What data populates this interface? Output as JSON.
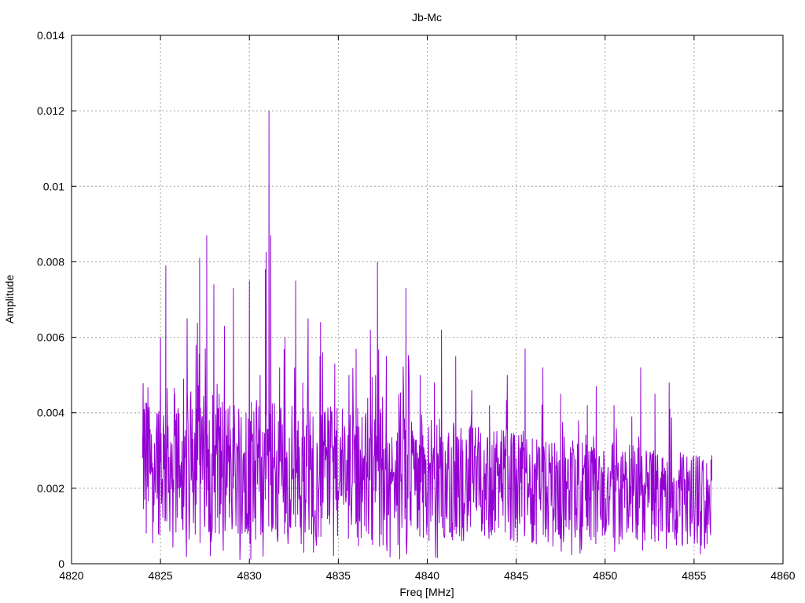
{
  "chart_data": {
    "type": "line",
    "title": "Jb-Mc",
    "xlabel": "Freq [MHz]",
    "ylabel": "Amplitude",
    "xlim": [
      4820,
      4860
    ],
    "ylim": [
      0,
      0.014
    ],
    "x_ticks": [
      "4820",
      "4825",
      "4830",
      "4835",
      "4840",
      "4845",
      "4850",
      "4855",
      "4860"
    ],
    "x_tick_values": [
      4820,
      4825,
      4830,
      4835,
      4840,
      4845,
      4850,
      4855,
      4860
    ],
    "y_ticks": [
      "0",
      "0.002",
      "0.004",
      "0.006",
      "0.008",
      "0.01",
      "0.012",
      "0.014"
    ],
    "y_tick_values": [
      0,
      0.002,
      0.004,
      0.006,
      0.008,
      0.01,
      0.012,
      0.014
    ],
    "grid": true,
    "legend": "none",
    "series": [
      {
        "color": "#9400d3",
        "x_start": 4824.0,
        "x_end": 4856.0,
        "points": [
          [
            4824.0,
            0.0028
          ],
          [
            4824.2,
            0.0008
          ],
          [
            4824.4,
            0.0024
          ],
          [
            4824.6,
            0.0011
          ],
          [
            4824.8,
            0.004
          ],
          [
            4825.0,
            0.006
          ],
          [
            4825.2,
            0.0025
          ],
          [
            4825.3,
            0.0079
          ],
          [
            4825.5,
            0.0018
          ],
          [
            4825.8,
            0.0045
          ],
          [
            4826.0,
            0.002
          ],
          [
            4826.3,
            0.0049
          ],
          [
            4826.5,
            0.0065
          ],
          [
            4826.8,
            0.0022
          ],
          [
            4827.0,
            0.0058
          ],
          [
            4827.2,
            0.0081
          ],
          [
            4827.4,
            0.003
          ],
          [
            4827.6,
            0.0087
          ],
          [
            4827.8,
            0.0002
          ],
          [
            4828.0,
            0.0074
          ],
          [
            4828.3,
            0.0045
          ],
          [
            4828.6,
            0.0063
          ],
          [
            4828.9,
            0.0016
          ],
          [
            4829.1,
            0.0073
          ],
          [
            4829.4,
            0.0041
          ],
          [
            4829.7,
            0.0029
          ],
          [
            4830.0,
            0.0075
          ],
          [
            4830.3,
            0.0012
          ],
          [
            4830.6,
            0.005
          ],
          [
            4830.9,
            0.0078
          ],
          [
            4831.1,
            0.012
          ],
          [
            4831.2,
            0.0087
          ],
          [
            4831.4,
            0.0028
          ],
          [
            4831.7,
            0.0052
          ],
          [
            4832.0,
            0.006
          ],
          [
            4832.3,
            0.0015
          ],
          [
            4832.6,
            0.0075
          ],
          [
            4833.0,
            0.0048
          ],
          [
            4833.3,
            0.0065
          ],
          [
            4833.6,
            0.0003
          ],
          [
            4834.0,
            0.0064
          ],
          [
            4834.4,
            0.0038
          ],
          [
            4834.8,
            0.0053
          ],
          [
            4835.2,
            0.0018
          ],
          [
            4835.6,
            0.005
          ],
          [
            4836.0,
            0.0057
          ],
          [
            4836.4,
            0.0028
          ],
          [
            4836.8,
            0.0062
          ],
          [
            4837.2,
            0.008
          ],
          [
            4837.4,
            0.004
          ],
          [
            4837.7,
            0.0055
          ],
          [
            4838.0,
            0.0021
          ],
          [
            4838.4,
            0.0045
          ],
          [
            4838.8,
            0.0073
          ],
          [
            4839.2,
            0.0034
          ],
          [
            4839.6,
            0.005
          ],
          [
            4840.0,
            0.001
          ],
          [
            4840.4,
            0.0048
          ],
          [
            4840.8,
            0.0062
          ],
          [
            4841.2,
            0.0025
          ],
          [
            4841.6,
            0.0055
          ],
          [
            4842.0,
            0.003
          ],
          [
            4842.5,
            0.0046
          ],
          [
            4843.0,
            0.0015
          ],
          [
            4843.5,
            0.0042
          ],
          [
            4844.0,
            0.0028
          ],
          [
            4844.5,
            0.005
          ],
          [
            4845.0,
            0.0012
          ],
          [
            4845.5,
            0.0057
          ],
          [
            4846.0,
            0.0025
          ],
          [
            4846.5,
            0.0052
          ],
          [
            4847.0,
            0.0032
          ],
          [
            4847.5,
            0.0045
          ],
          [
            4848.0,
            0.0018
          ],
          [
            4848.5,
            0.0038
          ],
          [
            4849.0,
            0.0042
          ],
          [
            4849.5,
            0.0047
          ],
          [
            4850.0,
            0.0008
          ],
          [
            4850.5,
            0.0042
          ],
          [
            4851.0,
            0.002
          ],
          [
            4851.5,
            0.0039
          ],
          [
            4852.0,
            0.0052
          ],
          [
            4852.4,
            0.0015
          ],
          [
            4852.8,
            0.0045
          ],
          [
            4853.2,
            0.0028
          ],
          [
            4853.6,
            0.0048
          ],
          [
            4854.0,
            0.0022
          ],
          [
            4854.4,
            0.0028
          ],
          [
            4854.8,
            0.001
          ],
          [
            4855.2,
            0.0025
          ],
          [
            4855.6,
            0.0004
          ],
          [
            4856.0,
            0.0022
          ]
        ]
      }
    ]
  }
}
